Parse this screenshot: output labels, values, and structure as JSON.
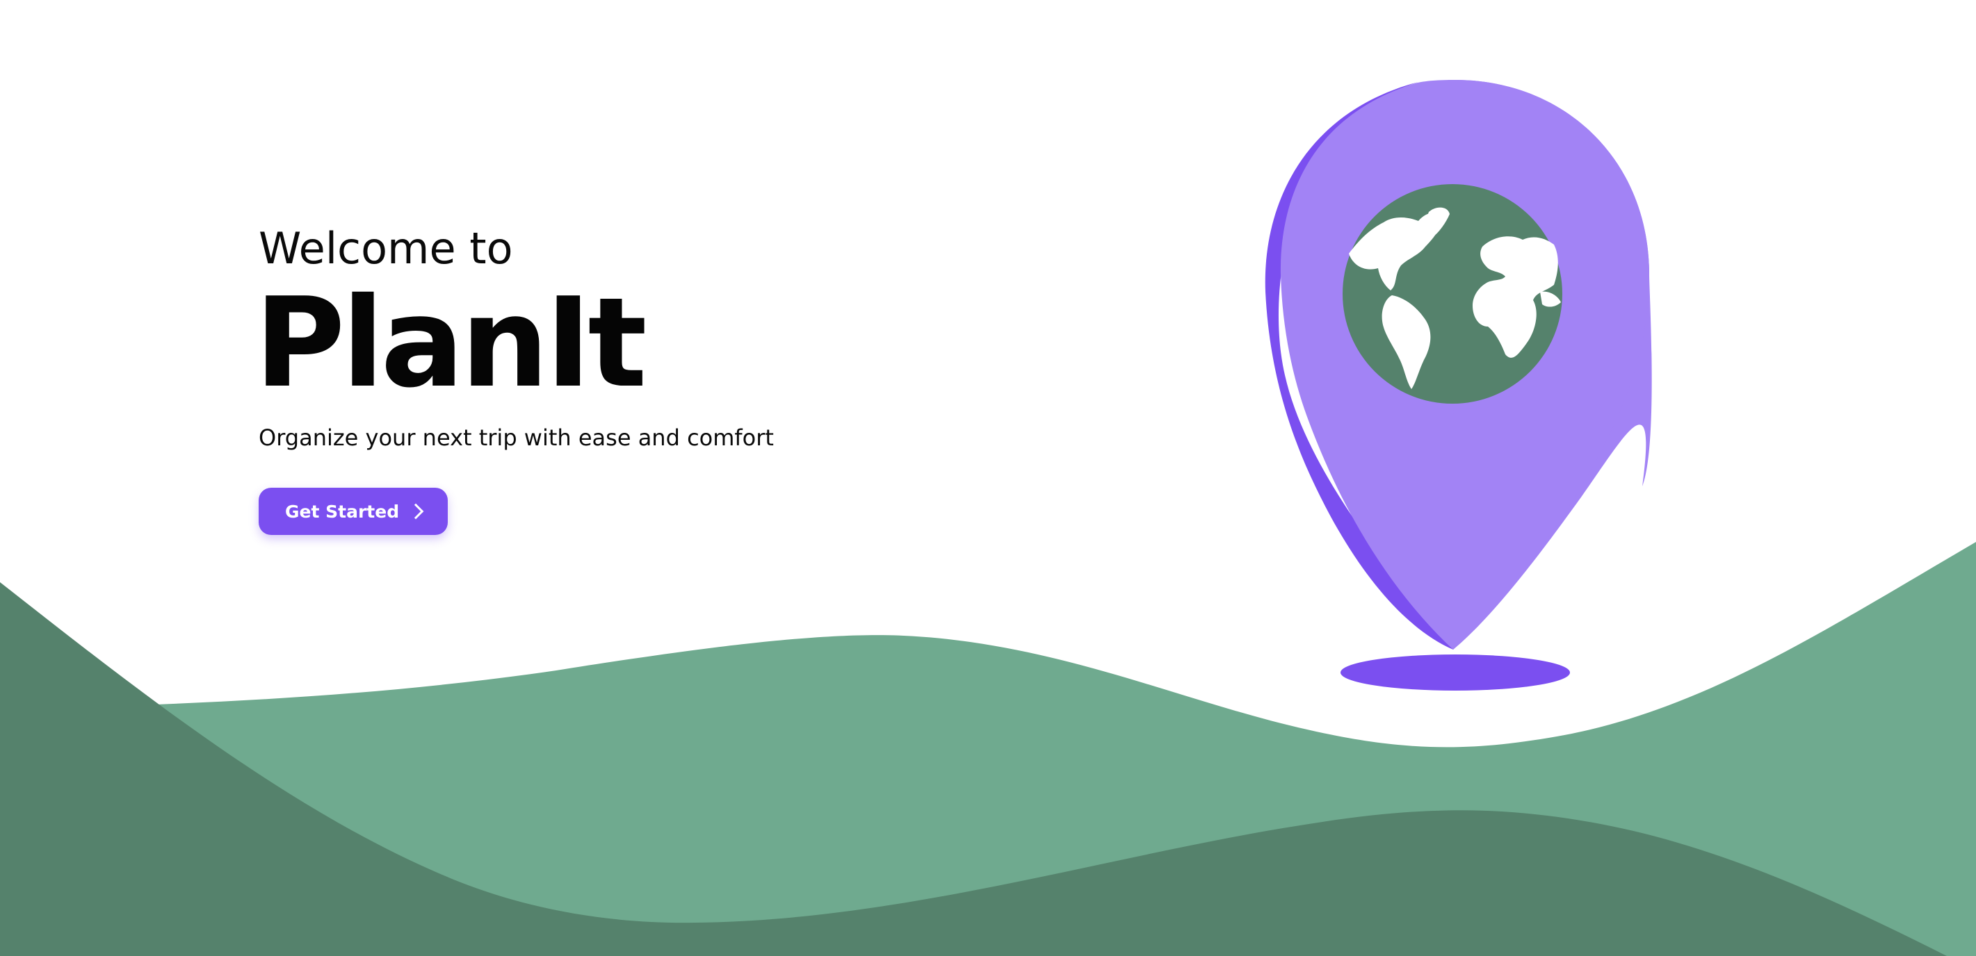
{
  "hero": {
    "welcome_text": "Welcome to",
    "app_name": "PlanIt",
    "tagline": "Organize your next trip with ease and comfort",
    "cta_label": "Get Started"
  },
  "icons": {
    "cta_icon": "chevron-right-icon",
    "illustration": "map-pin-globe-icon"
  },
  "colors": {
    "brand_purple": "#7b4ff0",
    "pin_light_purple": "#a283f5",
    "hill_light_green": "#6faa8f",
    "hill_dark_green": "#55826c",
    "globe_ocean": "#55826c",
    "continents": "#ffffff"
  }
}
